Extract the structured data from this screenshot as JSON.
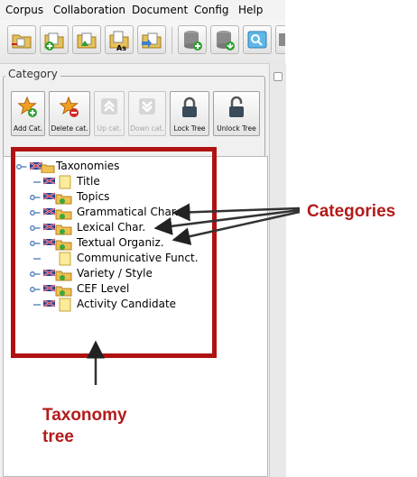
{
  "menubar": {
    "items": [
      "Corpus",
      "Collaboration",
      "Document",
      "Config",
      "Help"
    ]
  },
  "toolbar": {
    "buttons": [
      "open-corpus",
      "add-document",
      "export-document",
      "save-as",
      "import-document",
      "database-add",
      "database-download",
      "image-view",
      "database"
    ]
  },
  "category_panel": {
    "legend": "Category",
    "buttons": [
      {
        "label": "Add Cat.",
        "enabled": true
      },
      {
        "label": "Delete cat.",
        "enabled": true
      },
      {
        "label": "Up cat.",
        "enabled": false
      },
      {
        "label": "Down cat.",
        "enabled": false
      },
      {
        "label": "Lock Tree",
        "enabled": true
      },
      {
        "label": "Unlock Tree",
        "enabled": true
      }
    ]
  },
  "tree": {
    "root": "Taxonomies",
    "items": [
      {
        "label": "Title",
        "expandable": false
      },
      {
        "label": "Topics",
        "expandable": true
      },
      {
        "label": "Grammatical Char.",
        "expandable": true
      },
      {
        "label": "Lexical Char.",
        "expandable": true
      },
      {
        "label": "Textual Organiz.",
        "expandable": true
      },
      {
        "label": "Communicative Funct.",
        "expandable": false
      },
      {
        "label": "Variety / Style",
        "expandable": true
      },
      {
        "label": "CEF Level",
        "expandable": true
      },
      {
        "label": "Activity Candidate",
        "expandable": false
      }
    ]
  },
  "annotations": {
    "categories": "Categories",
    "taxonomy_line1": "Taxonomy",
    "taxonomy_line2": "tree",
    "color": "#b01212"
  }
}
